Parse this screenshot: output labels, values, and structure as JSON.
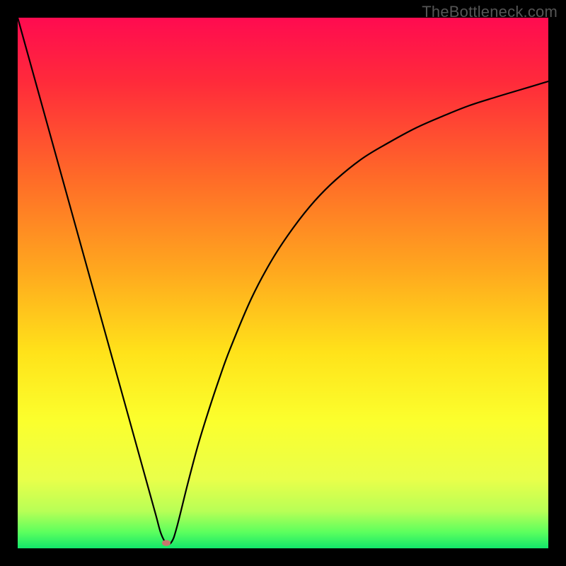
{
  "watermark": "TheBottleneck.com",
  "chart_data": {
    "type": "line",
    "title": "",
    "xlabel": "",
    "ylabel": "",
    "xlim": [
      0,
      100
    ],
    "ylim": [
      0,
      100
    ],
    "x": [
      0,
      2,
      4,
      6,
      8,
      10,
      12,
      14,
      16,
      18,
      20,
      22,
      24,
      26,
      27,
      28,
      29,
      30,
      32,
      34,
      36,
      38,
      40,
      44,
      48,
      52,
      56,
      60,
      65,
      70,
      75,
      80,
      85,
      90,
      95,
      100
    ],
    "values": [
      100,
      92.8,
      85.6,
      78.4,
      71.2,
      64.0,
      56.8,
      49.6,
      42.4,
      35.2,
      28.0,
      20.8,
      13.6,
      6.4,
      2.8,
      1.0,
      1.2,
      4.0,
      12.0,
      19.5,
      26.0,
      32.0,
      37.5,
      47.0,
      54.5,
      60.5,
      65.5,
      69.5,
      73.5,
      76.5,
      79.2,
      81.4,
      83.4,
      85.0,
      86.5,
      88.0
    ],
    "minimum_marker": {
      "x": 28,
      "y": 1.0
    },
    "gradient_stops": [
      {
        "pct": 0,
        "color": "#ff0b50"
      },
      {
        "pct": 12,
        "color": "#ff2a3b"
      },
      {
        "pct": 30,
        "color": "#ff6a28"
      },
      {
        "pct": 48,
        "color": "#ffa91e"
      },
      {
        "pct": 63,
        "color": "#ffe21a"
      },
      {
        "pct": 76,
        "color": "#fbff2d"
      },
      {
        "pct": 87,
        "color": "#e9ff4a"
      },
      {
        "pct": 93,
        "color": "#b8ff56"
      },
      {
        "pct": 97,
        "color": "#5bff5e"
      },
      {
        "pct": 100,
        "color": "#12e66a"
      }
    ]
  }
}
